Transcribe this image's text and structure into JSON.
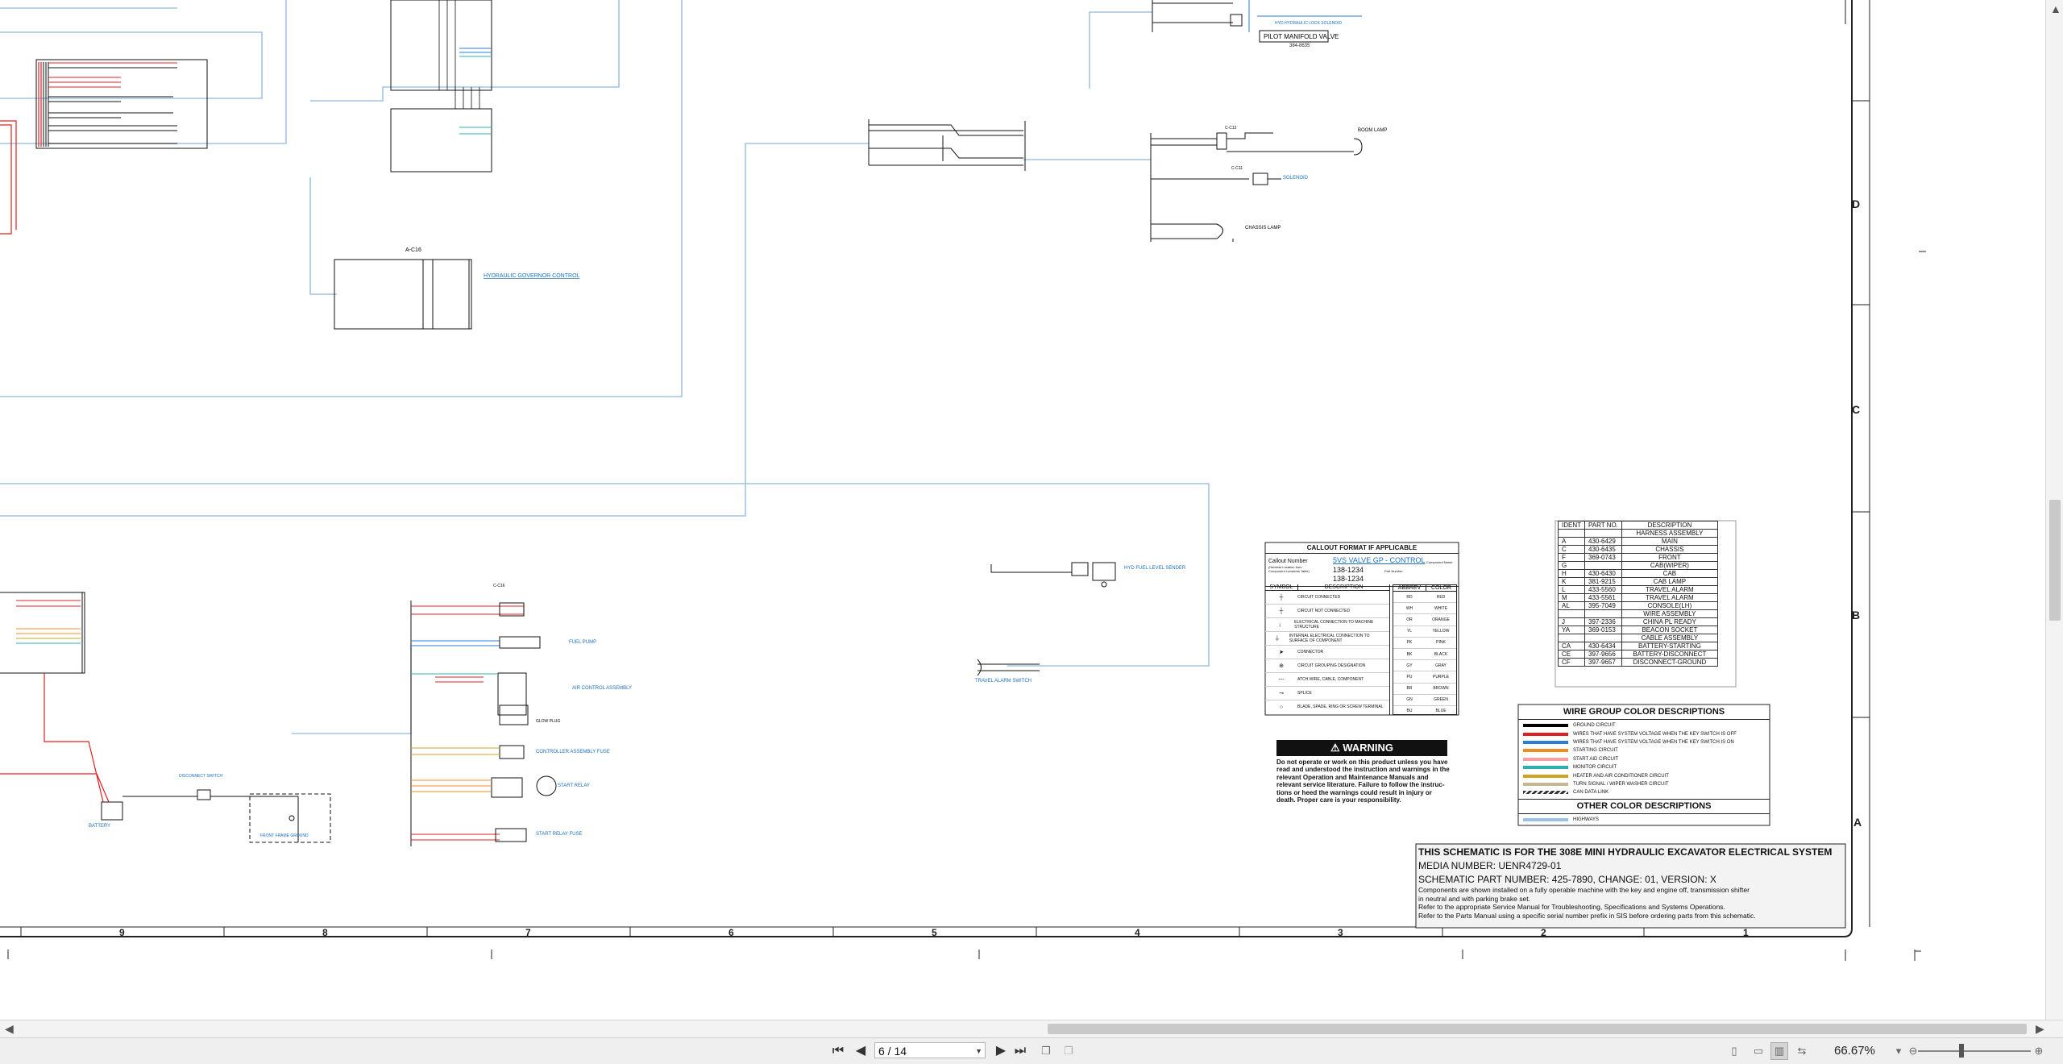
{
  "schematic": {
    "grid_columns": [
      "9",
      "8",
      "7",
      "6",
      "5",
      "4",
      "3",
      "2",
      "1"
    ],
    "grid_rows": [
      "D",
      "C",
      "B",
      "A"
    ],
    "title_block": {
      "title": "THIS SCHEMATIC IS FOR THE 308E MINI HYDRAULIC EXCAVATOR ELECTRICAL SYSTEM",
      "media_number": "MEDIA NUMBER: UENR4729-01",
      "part_number": "SCHEMATIC PART NUMBER: 425-7890, CHANGE: 01, VERSION: X",
      "notes": [
        "Components are shown installed on a fully operable machine with the key and engine off, transmission shifter",
        "in neutral and with parking brake set.",
        "Refer to the appropriate Service Manual for Troubleshooting, Specifications and Systems Operations.",
        "Refer to the Parts Manual using a specific serial number prefix in SIS before ordering parts from this schematic."
      ]
    },
    "ident_table": {
      "headers": [
        "IDENT",
        "PART NO.",
        "DESCRIPTION"
      ],
      "subheader": "HARNESS ASSEMBLY",
      "rows": [
        [
          "A",
          "430-6429",
          "MAIN"
        ],
        [
          "C",
          "430-6435",
          "CHASSIS"
        ],
        [
          "F",
          "369-0743",
          "FRONT"
        ],
        [
          "G",
          "",
          "CAB(WIPER)"
        ],
        [
          "H",
          "430-6430",
          "CAB"
        ],
        [
          "K",
          "381-9215",
          "CAB LAMP"
        ],
        [
          "L",
          "433-5560",
          "TRAVEL ALARM"
        ],
        [
          "M",
          "433-5561",
          "TRAVEL ALARM"
        ],
        [
          "AL",
          "395-7049",
          "CONSOLE(LH)"
        ],
        [
          "",
          "",
          "WIRE ASSEMBLY"
        ],
        [
          "J",
          "397-2336",
          "CHINA PL READY"
        ],
        [
          "YA",
          "369-0153",
          "BEACON SOCKET"
        ],
        [
          "",
          "",
          "CABLE ASSEMBLY"
        ],
        [
          "CA",
          "430-6434",
          "BATTERY-STARTING"
        ],
        [
          "CE",
          "397-9656",
          "BATTERY-DISCONNECT"
        ],
        [
          "CF",
          "397-9657",
          "DISCONNECT-GROUND"
        ]
      ]
    },
    "wire_group": {
      "title": "WIRE GROUP COLOR DESCRIPTIONS",
      "items": [
        {
          "color": "#000000",
          "label": "GROUND CIRCUIT"
        },
        {
          "color": "#e02020",
          "label": "WIRES THAT HAVE SYSTEM VOLTAGE WHEN THE KEY SWITCH IS OFF"
        },
        {
          "color": "#2a7fd4",
          "label": "WIRES THAT HAVE SYSTEM VOLTAGE WHEN THE KEY SWITCH IS ON"
        },
        {
          "color": "#f08c20",
          "label": "STARTING CIRCUIT"
        },
        {
          "color": "#f4a0a0",
          "label": "START AID CIRCUIT"
        },
        {
          "color": "#30b0b0",
          "label": "MONITOR CIRCUIT"
        },
        {
          "color": "#d4a020",
          "label": "HEATER AND AIR CONDITIONER CIRCUIT"
        },
        {
          "color": "#c8b890",
          "label": "TURN SIGNAL / WIPER WASHER CIRCUIT"
        },
        {
          "color": "#555555",
          "label": "CAN DATA LINK"
        }
      ],
      "other_title": "OTHER COLOR DESCRIPTIONS",
      "other_items": [
        {
          "color": "#9cc0e8",
          "label": "HIGHWAYS"
        }
      ]
    },
    "callout": {
      "title": "CALLOUT FORMAT IF APPLICABLE",
      "label": "Callout Number",
      "sublabel": "(Harness Location from Component Locations Table)",
      "link": "5VS VALVE GP - CONTROL",
      "part": "138-1234",
      "part2": "138-1234",
      "right_note": "Component Name",
      "part_note": "Part Number",
      "symbol_headers": [
        "SYMBOL",
        "DESCRIPTION"
      ],
      "symbols": [
        {
          "glyph": "┼",
          "text": "CIRCUIT CONNECTED"
        },
        {
          "glyph": "┼",
          "text": "CIRCUIT NOT CONNECTED"
        },
        {
          "glyph": "↓",
          "text": "ELECTRICAL CONNECTION TO MACHINE STRUCTURE"
        },
        {
          "glyph": "⏚",
          "text": "INTERNAL ELECTRICAL CONNECTION TO SURFACE OF COMPONENT"
        },
        {
          "glyph": "➤",
          "text": "CONNECTOR"
        },
        {
          "glyph": "⊕",
          "text": "CIRCUIT GROUPING DESIGNATION"
        },
        {
          "glyph": "---",
          "text": "ATCH WIRE, CABLE, COMPONENT"
        },
        {
          "glyph": "⊸",
          "text": "SPLICE"
        },
        {
          "glyph": "○",
          "text": "BLADE, SPADE, RING OR SCREW TERMINAL"
        }
      ],
      "color_headers": [
        "ABBREV",
        "COLOR"
      ],
      "colors": [
        [
          "RD",
          "RED"
        ],
        [
          "WH",
          "WHITE"
        ],
        [
          "OR",
          "ORANGE"
        ],
        [
          "YL",
          "YELLOW"
        ],
        [
          "PK",
          "PINK"
        ],
        [
          "BK",
          "BLACK"
        ],
        [
          "GY",
          "GRAY"
        ],
        [
          "PU",
          "PURPLE"
        ],
        [
          "BR",
          "BROWN"
        ],
        [
          "GN",
          "GREEN"
        ],
        [
          "BU",
          "BLUE"
        ]
      ]
    },
    "warning": {
      "title": "WARNING",
      "lines": [
        "Do not operate or work on this product unless you have",
        "read and understood the instruction and warnings in the",
        "relevant Operation and Maintenance Manuals and",
        "relevant service literature. Failure to follow the instruc-",
        "tions or heed the warnings could result in injury or",
        "death. Proper care is your responsibility."
      ]
    },
    "component_labels": {
      "pilot_manifold": "PILOT MANIFOLD VALVE",
      "pilot_manifold_pn": "384-8635",
      "hyd_lock_solenoid": "HYD HYDRAULIC LOCK SOLENOID",
      "hydraulic_governor": "HYDRAULIC GOVERNOR CONTROL",
      "boom_lamp": "BOOM LAMP",
      "solenoid_valve": "SOLENOID",
      "chassis_lamp": "CHASSIS LAMP",
      "fuel_level_sender": "HYD FUEL LEVEL SENDER",
      "travel_alarm": "TRAVEL ALARM SWITCH",
      "fuel_pump": "FUEL PUMP",
      "air_control": "AIR CONTROL ASSEMBLY",
      "controller_fuse": "CONTROLLER ASSEMBLY FUSE",
      "start_relay": "START RELAY",
      "glow_plug": "GLOW PLUG",
      "battery": "BATTERY",
      "disconnect_switch": "DISCONNECT SWITCH",
      "front_frame_ground": "FRONT FRAME GROUND",
      "start_relay_fuse": "START RELAY FUSE",
      "connector_a": "A-C16",
      "connector_b": "C-C16",
      "connector_c": "C-C11",
      "connector_d": "C-C12"
    }
  },
  "toolbar": {
    "first_page": "⏮",
    "prev_page": "◀",
    "page_value": "6 / 14",
    "next_page": "▶",
    "last_page": "⏭",
    "zoom": "66.67%",
    "zoom_out": "⊖",
    "zoom_in": "⊕"
  }
}
